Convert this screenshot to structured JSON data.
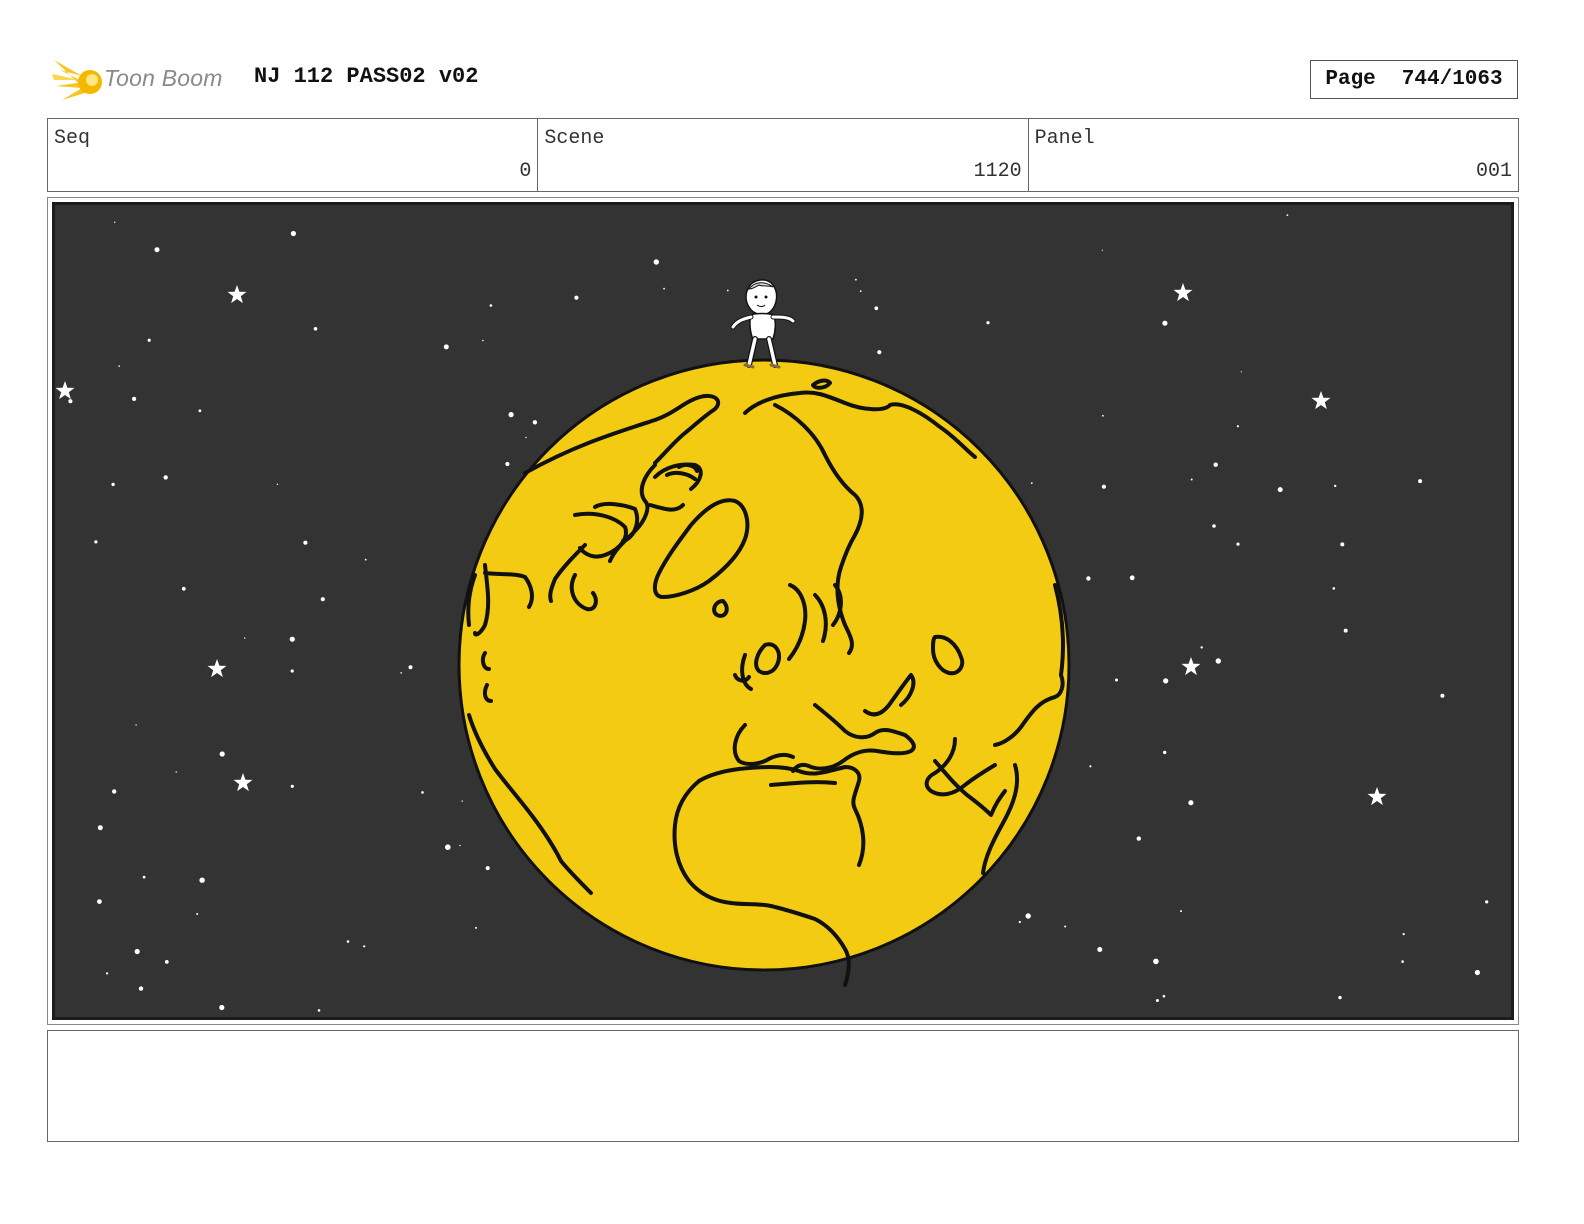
{
  "header": {
    "logo_text": "Toon Boom",
    "title": "NJ 112 PASS02 v02",
    "page_label": "Page",
    "page_number": "744/1063"
  },
  "info": {
    "seq_label": "Seq",
    "seq_value": "0",
    "scene_label": "Scene",
    "scene_value": "1120",
    "panel_label": "Panel",
    "panel_value": "001"
  },
  "notes": "",
  "colors": {
    "space": "#333333",
    "globe": "#f2cb12",
    "outline": "#111111",
    "star": "#ffffff",
    "logo_flame": "#f7c51e"
  },
  "icons": {
    "logo": "toon-boom-flame-icon",
    "figure": "standing-boy-figure",
    "globe": "earth-globe"
  }
}
